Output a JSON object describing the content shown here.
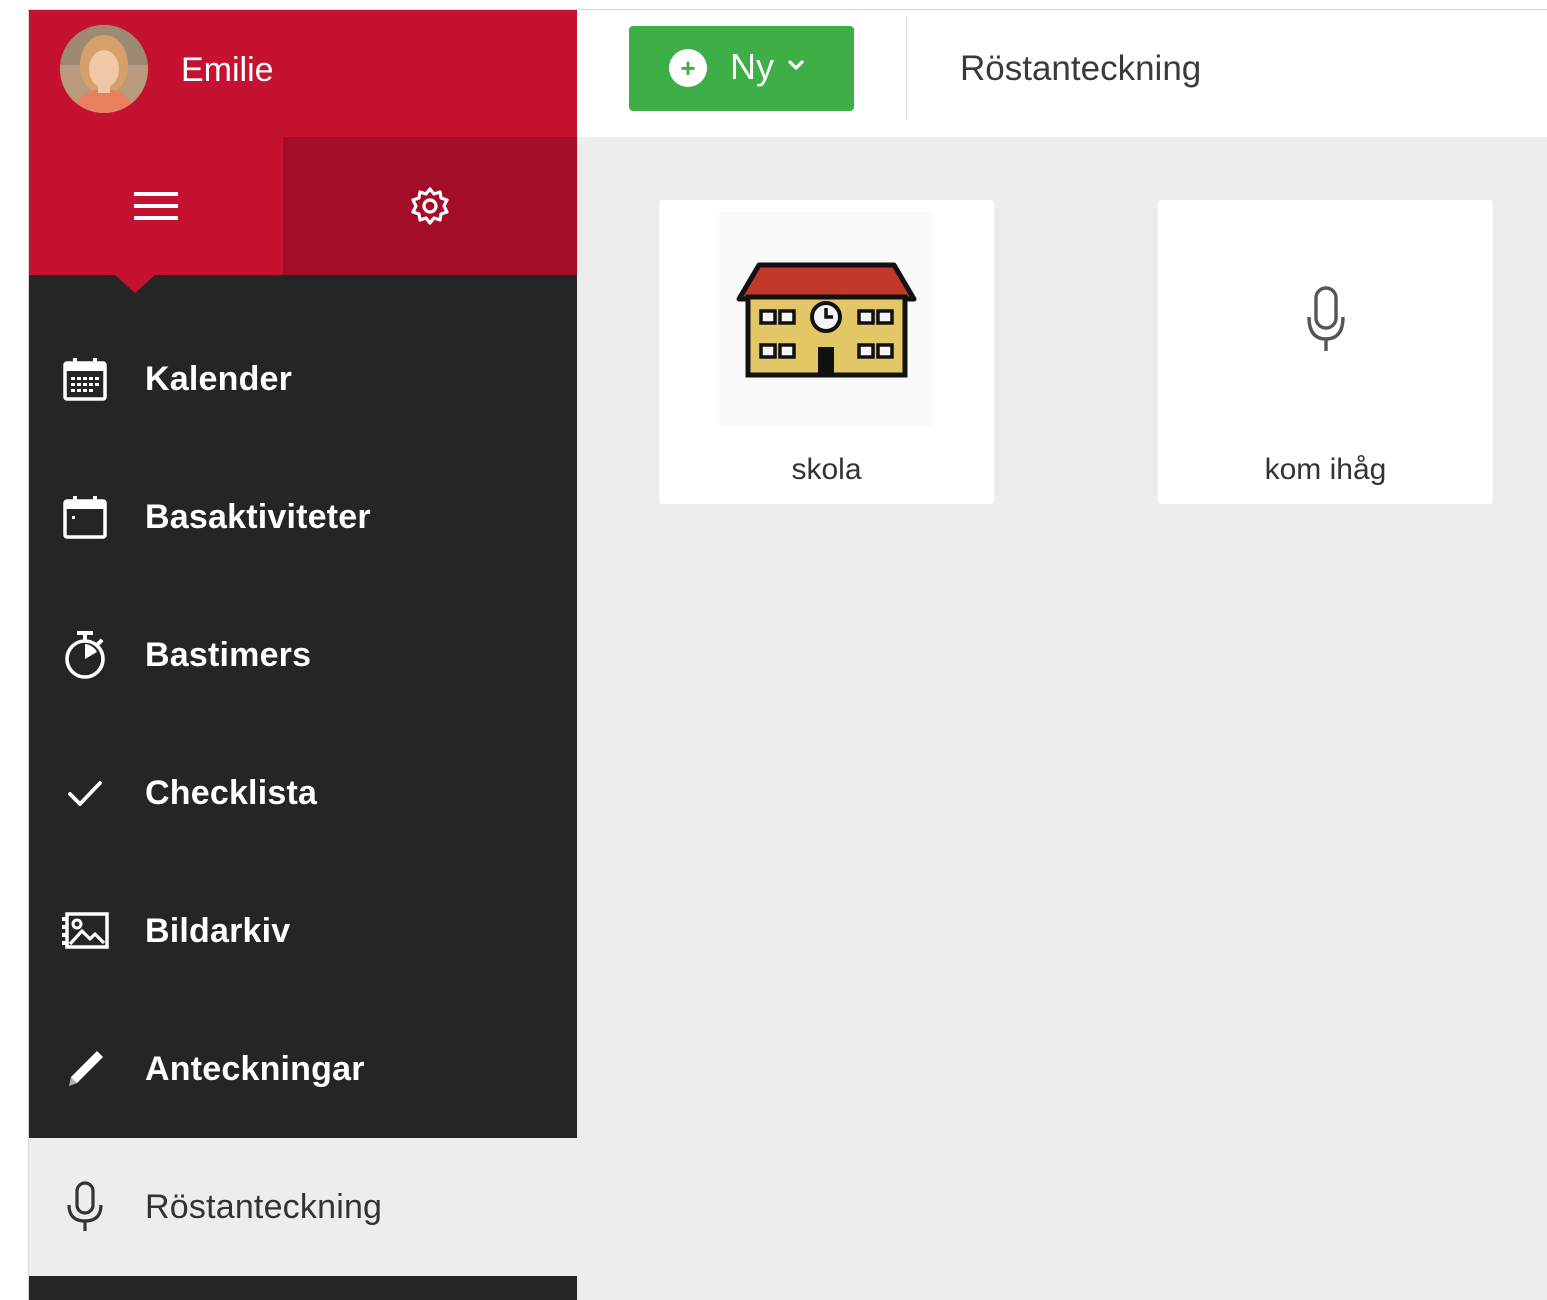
{
  "user": {
    "name": "Emilie"
  },
  "header": {
    "new_button_label": "Ny",
    "page_title": "Röstanteckning"
  },
  "nav": {
    "items": [
      {
        "label": "Kalender",
        "icon": "calendar-icon"
      },
      {
        "label": "Basaktiviteter",
        "icon": "calendar-blank-icon"
      },
      {
        "label": "Bastimers",
        "icon": "timer-icon"
      },
      {
        "label": "Checklista",
        "icon": "checkmark-icon"
      },
      {
        "label": "Bildarkiv",
        "icon": "image-archive-icon"
      },
      {
        "label": "Anteckningar",
        "icon": "pencil-icon"
      },
      {
        "label": "Röstanteckning",
        "icon": "microphone-icon",
        "active": true
      }
    ]
  },
  "cards": [
    {
      "label": "skola",
      "icon": "school-building-icon"
    },
    {
      "label": "kom ihåg",
      "icon": "microphone-icon"
    }
  ],
  "colors": {
    "brand_red": "#c41230",
    "brand_red_dark": "#a30d27",
    "sidebar_bg": "#252525",
    "accent_green": "#3eaf47",
    "content_bg": "#ededed"
  }
}
